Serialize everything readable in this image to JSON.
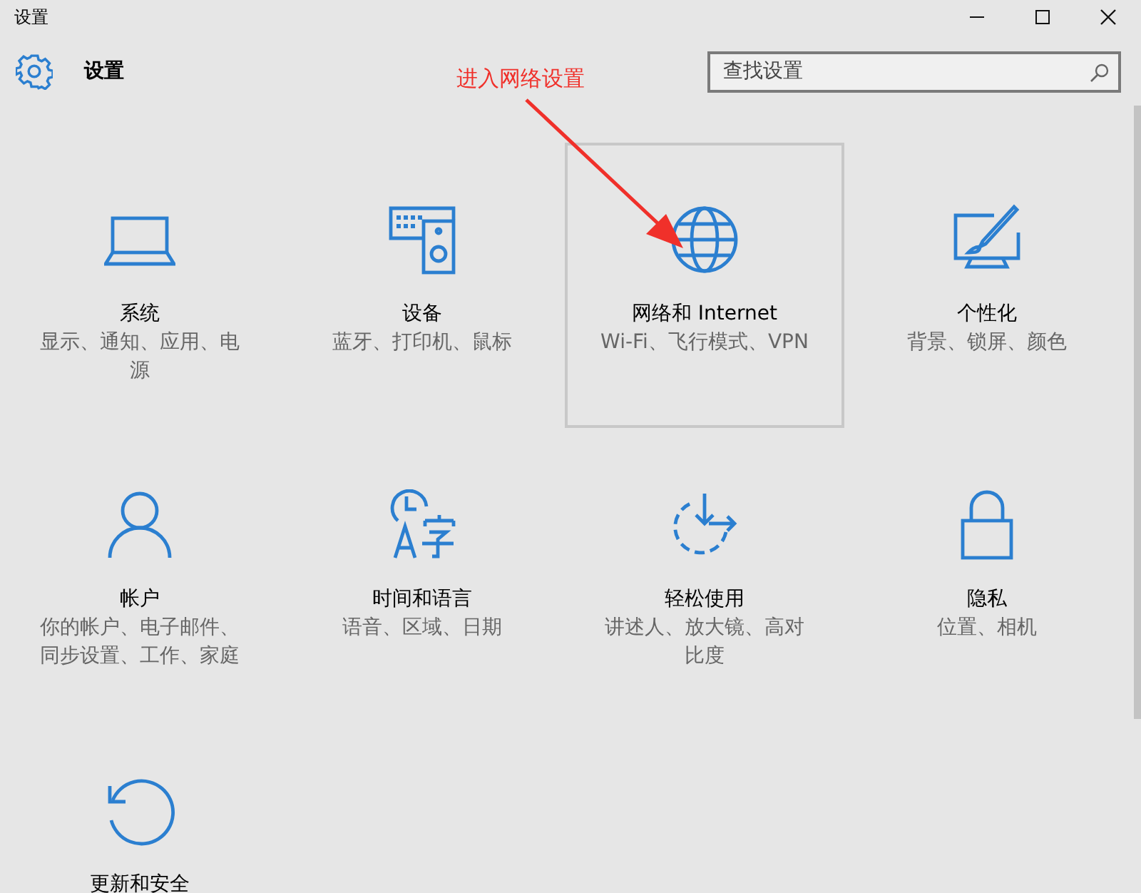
{
  "window": {
    "title": "设置"
  },
  "header": {
    "title": "设置"
  },
  "search": {
    "placeholder": "查找设置"
  },
  "annotation": {
    "text": "进入网络设置"
  },
  "tiles": [
    {
      "kind": "laptop",
      "title": "系统",
      "subtitle": "显示、通知、应用、电源",
      "selected": false
    },
    {
      "kind": "devices",
      "title": "设备",
      "subtitle": "蓝牙、打印机、鼠标",
      "selected": false
    },
    {
      "kind": "globe",
      "title": "网络和 Internet",
      "subtitle": "Wi-Fi、飞行模式、VPN",
      "selected": true
    },
    {
      "kind": "paint",
      "title": "个性化",
      "subtitle": "背景、锁屏、颜色",
      "selected": false
    },
    {
      "kind": "person",
      "title": "帐户",
      "subtitle": "你的帐户、电子邮件、同步设置、工作、家庭",
      "selected": false
    },
    {
      "kind": "timelang",
      "title": "时间和语言",
      "subtitle": "语音、区域、日期",
      "selected": false
    },
    {
      "kind": "ease",
      "title": "轻松使用",
      "subtitle": "讲述人、放大镜、高对比度",
      "selected": false
    },
    {
      "kind": "lock",
      "title": "隐私",
      "subtitle": "位置、相机",
      "selected": false
    },
    {
      "kind": "update",
      "title": "更新和安全",
      "selected": false
    }
  ]
}
